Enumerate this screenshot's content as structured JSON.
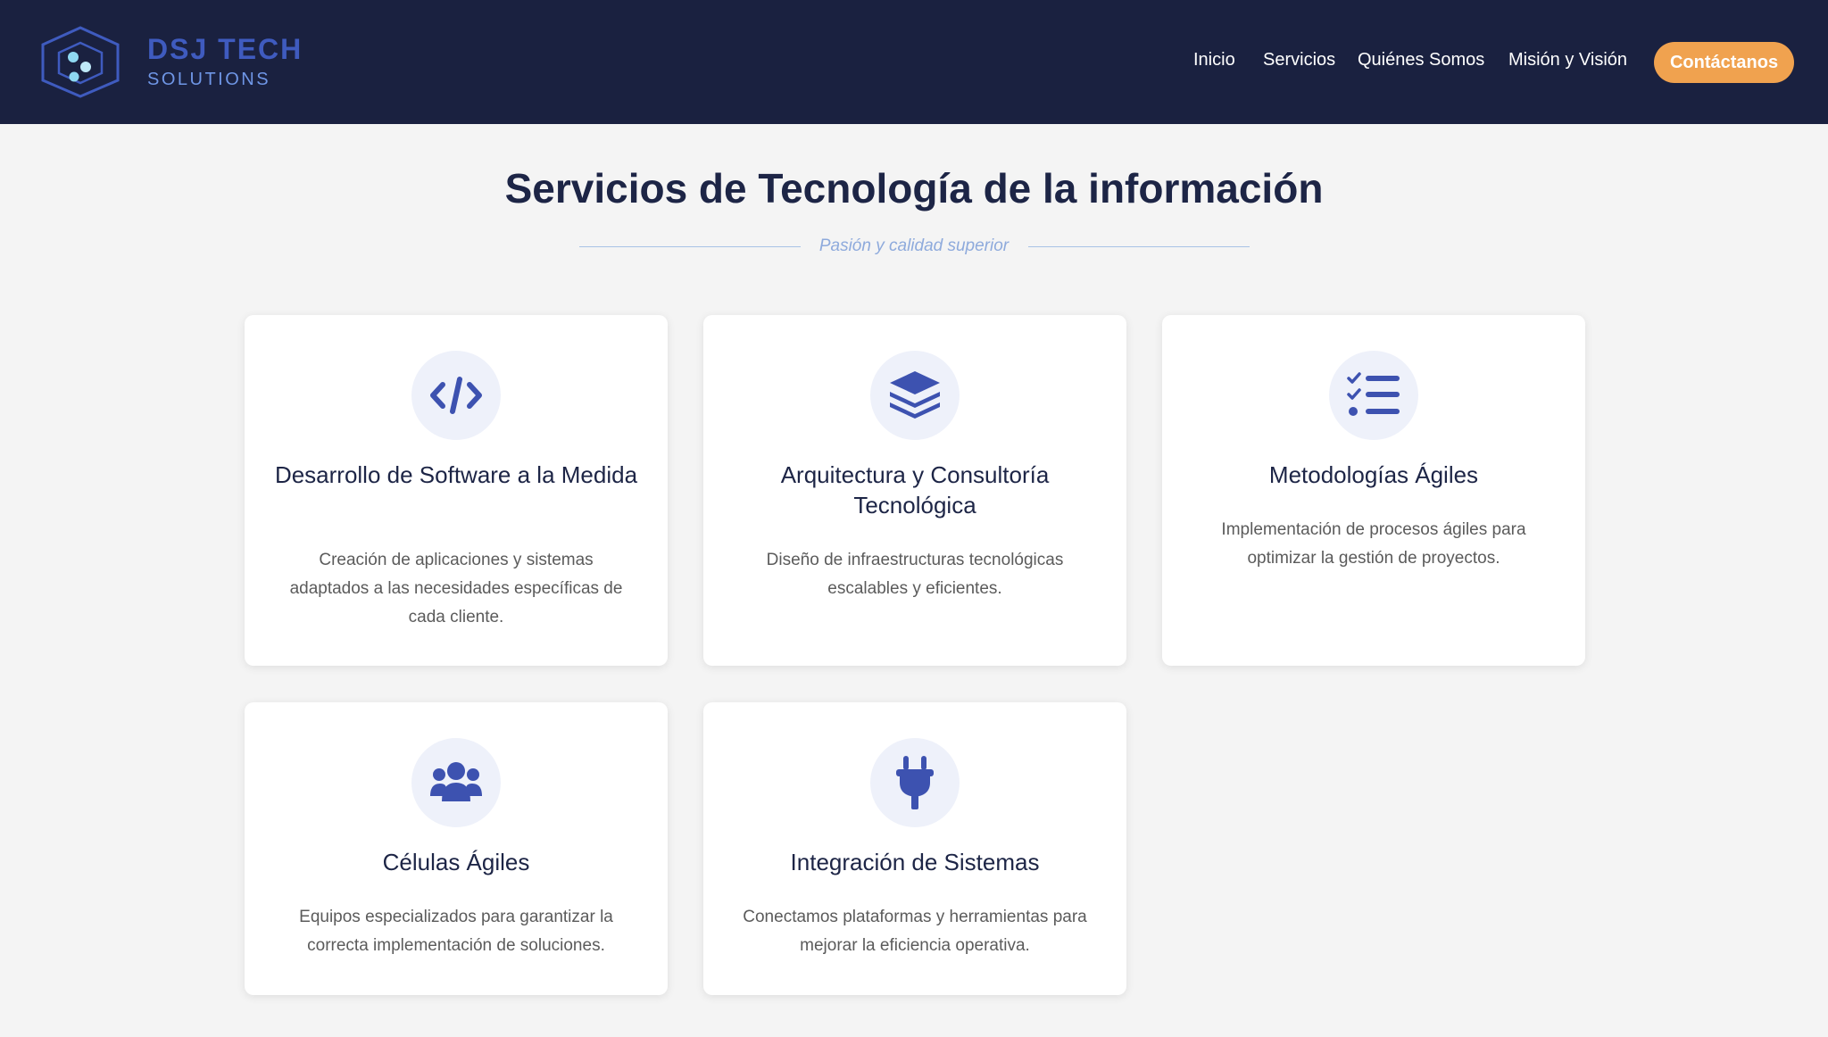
{
  "header": {
    "brand_name": "DSJ TECH",
    "brand_tagline": "SOLUTIONS",
    "logo_icon": "hexagon-molecule-icon",
    "nav": [
      "Inicio",
      "Servicios",
      "Quiénes Somos",
      "Misión y Visión"
    ],
    "cta_label": "Contáctanos"
  },
  "main": {
    "title": "Servicios de Tecnología de la información",
    "subtitle": "Pasión y calidad superior"
  },
  "services": [
    {
      "icon": "code-icon",
      "title": "Desarrollo de Software a la Medida",
      "description": "Creación de aplicaciones y sistemas adaptados a las necesidades específicas de cada cliente."
    },
    {
      "icon": "layers-icon",
      "title": "Arquitectura y Consultoría Tecnológica",
      "description": "Diseño de infraestructuras tecnológicas escalables y eficientes."
    },
    {
      "icon": "checklist-icon",
      "title": "Metodologías Ágiles",
      "description": "Implementación de procesos ágiles para optimizar la gestión de proyectos."
    },
    {
      "icon": "users-icon",
      "title": "Células Ágiles",
      "description": "Equipos especializados para garantizar la correcta implementación de soluciones."
    },
    {
      "icon": "plug-icon",
      "title": "Integración de Sistemas",
      "description": "Conectamos plataformas y herramientas para mejorar la eficiencia operativa."
    }
  ],
  "colors": {
    "header_bg": "#1a2140",
    "accent": "#f0a24f",
    "brand_blue": "#3f5bbf",
    "icon_blue": "#3d52b0"
  }
}
